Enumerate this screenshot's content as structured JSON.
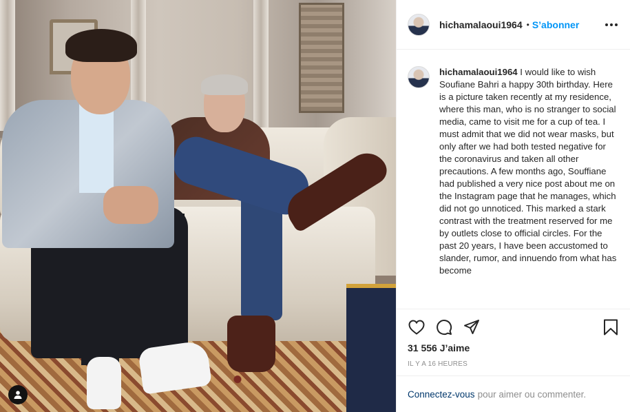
{
  "post": {
    "username": "hichamalaoui1964",
    "follow_label": "S’abonner",
    "separator": "•",
    "caption_text": "I would like to wish Soufiane Bahri a happy 30th birthday. Here is a picture taken recently at my residence, where this man, who is no stranger to social media, came to visit me for a cup of tea. I must admit that we did not wear masks, but only after we had both tested negative for the coronavirus and taken all other precautions. A few months ago, Souffiane had published a very nice post about me on the Instagram page that he manages, which did not go unnoticed. This marked a stark contrast with the treatment reserved for me by outlets close to official circles. For the past 20 years, I have been accustomed to slander, rumor, and innuendo from what has become",
    "likes": "31 556 J’aime",
    "timestamp": "IL Y A 16 HEURES"
  },
  "footer": {
    "login_link": "Connectez-vous",
    "login_suffix": "pour aimer ou commenter."
  },
  "icons": {
    "more": "more-options-icon",
    "like": "heart-icon",
    "comment": "comment-icon",
    "share": "paper-plane-icon",
    "save": "bookmark-icon",
    "tags": "user-tag-icon"
  }
}
